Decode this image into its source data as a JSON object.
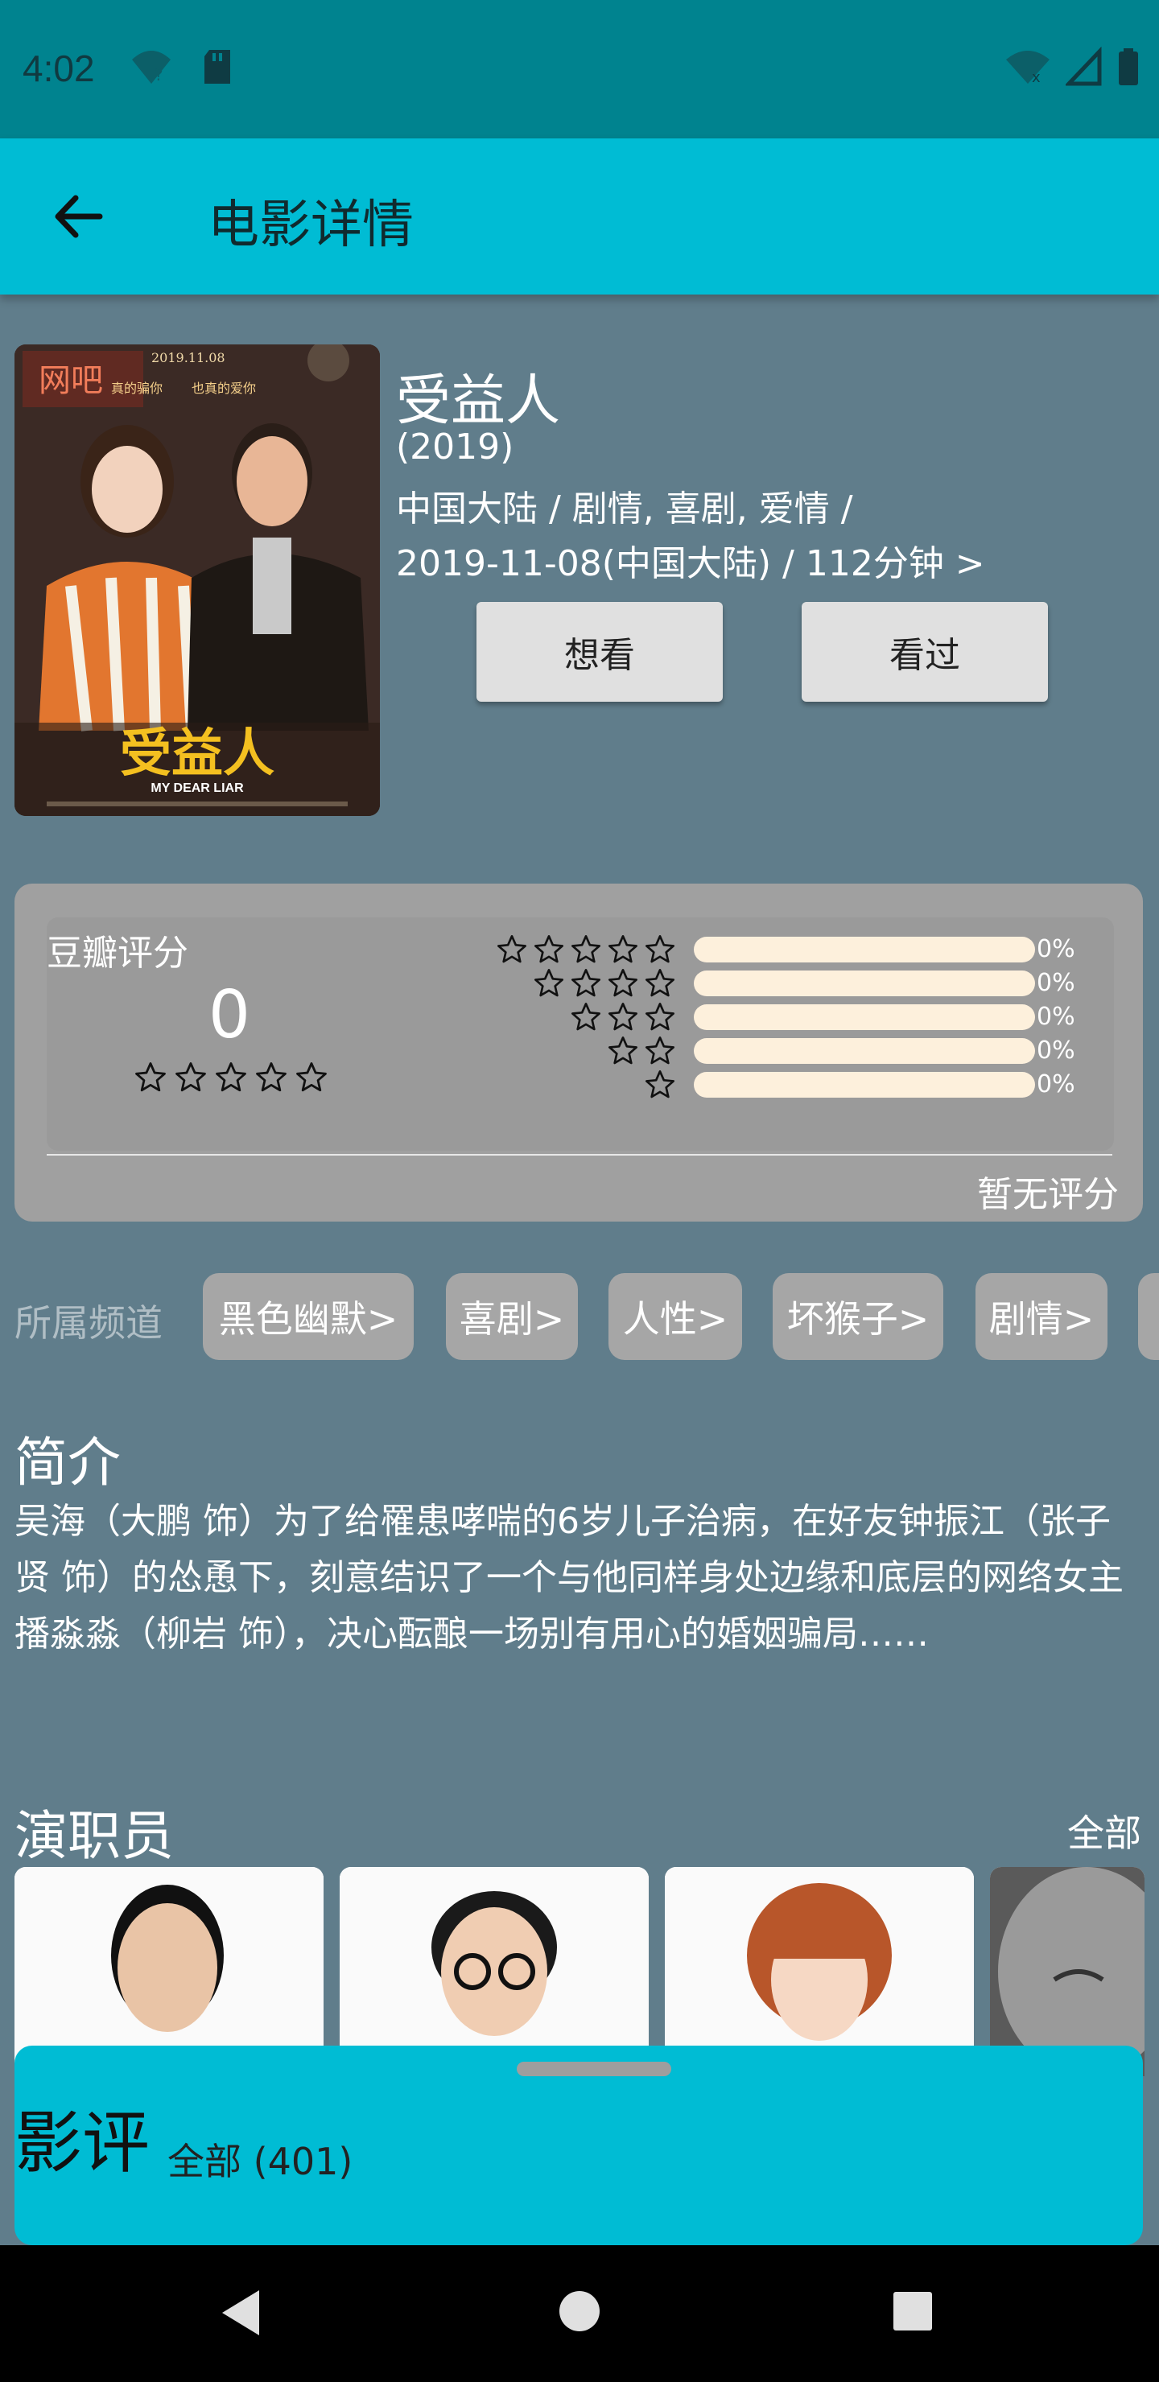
{
  "status_bar": {
    "time": "4:02"
  },
  "app_bar": {
    "title": "电影详情"
  },
  "movie": {
    "title": "受益人",
    "year": "(2019)",
    "meta_line1": "中国大陆 / 剧情, 喜剧, 爱情 /",
    "meta_line2": "2019-11-08(中国大陆) / 112分钟 >",
    "want_button": "想看",
    "watched_button": "看过",
    "poster": {
      "date_text": "2019.11.08",
      "sign_text": "网吧",
      "slogan_left": "真的骗你",
      "slogan_right": "也真的爱你",
      "title_text": "受益人",
      "english_title": "MY DEAR LIAR"
    }
  },
  "rating": {
    "label": "豆瓣评分",
    "score": "0",
    "rows": [
      {
        "stars": 5,
        "fraction": 0,
        "percent_label": "0%"
      },
      {
        "stars": 4,
        "fraction": 0,
        "percent_label": "0%"
      },
      {
        "stars": 3,
        "fraction": 0,
        "percent_label": "0%"
      },
      {
        "stars": 2,
        "fraction": 0,
        "percent_label": "0%"
      },
      {
        "stars": 1,
        "fraction": 0,
        "percent_label": "0%"
      }
    ],
    "no_rating_text": "暂无评分"
  },
  "channels": {
    "label": "所属频道",
    "chips": [
      "黑色幽默>",
      "喜剧>",
      "人性>",
      "坏猴子>",
      "剧情>"
    ]
  },
  "synopsis": {
    "title": "简介",
    "text": "吴海（大鹏 饰）为了给罹患哮喘的6岁儿子治病，在好友钟振江（张子贤 饰）的怂恿下，刻意结识了一个与他同样身处边缘和底层的网络女主播淼淼（柳岩 饰），决心酝酿一场别有用心的婚姻骗局……"
  },
  "cast": {
    "title": "演职员",
    "all_link": "全部"
  },
  "reviews": {
    "title": "影评",
    "count_text": "全部 (401)"
  },
  "colors": {
    "status_bar": "#00838f",
    "app_bar": "#00bcd4",
    "background": "#607d8b",
    "rating_card": "#a0a0a0",
    "bar_track": "#fdf0dc"
  }
}
